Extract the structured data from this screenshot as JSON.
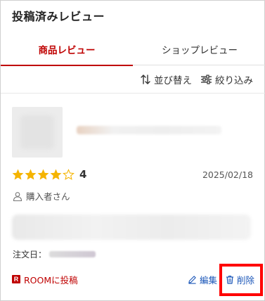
{
  "page": {
    "title": "投稿済みレビュー"
  },
  "tabs": [
    {
      "label": "商品レビュー",
      "active": true
    },
    {
      "label": "ショップレビュー",
      "active": false
    }
  ],
  "toolbar": {
    "sort_label": "並び替え",
    "filter_label": "絞り込み"
  },
  "review": {
    "rating": 4,
    "rating_label": "4",
    "max_rating": 5,
    "date": "2025/02/18",
    "reviewer": "購入者さん",
    "order_label": "注文日：",
    "room_label": "ROOMに投稿",
    "room_logo": "R",
    "edit_label": "編集",
    "delete_label": "削除"
  },
  "colors": {
    "accent": "#bf0000",
    "star": "#f5b400",
    "link": "#1a56b8",
    "highlight": "#ff0000"
  },
  "icons": {
    "sort": "sort-arrows-icon",
    "filter": "sliders-icon",
    "reviewer": "user-icon",
    "edit": "pencil-icon",
    "delete": "trash-icon",
    "room": "room-logo-icon"
  }
}
